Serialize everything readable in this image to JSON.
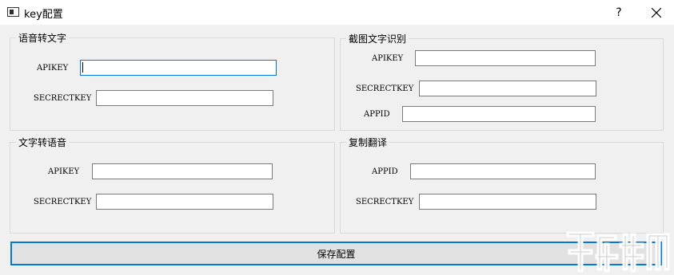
{
  "window": {
    "title": "key配置",
    "help_label": "?"
  },
  "groups": {
    "speech_to_text": {
      "title": "语音转文字",
      "apikey_label": "APIKEY",
      "secret_label": "SECRECTKEY",
      "apikey_value": "",
      "secret_value": ""
    },
    "ocr": {
      "title": "截图文字识别",
      "apikey_label": "APIKEY",
      "secret_label": "SECRECTKEY",
      "appid_label": "APPID",
      "apikey_value": "",
      "secret_value": "",
      "appid_value": ""
    },
    "text_to_speech": {
      "title": "文字转语音",
      "apikey_label": "APIKEY",
      "secret_label": "SECRECTKEY",
      "apikey_value": "",
      "secret_value": ""
    },
    "translate": {
      "title": "复制翻译",
      "appid_label": "APPID",
      "secret_label": "SECRECTKEY",
      "appid_value": "",
      "secret_value": ""
    }
  },
  "save_button": {
    "label": "保存配置"
  },
  "icons": {
    "app": "window-icon",
    "close": "close-icon"
  },
  "colors": {
    "focus_accent": "#0078d7",
    "background": "#f0f0f0"
  }
}
